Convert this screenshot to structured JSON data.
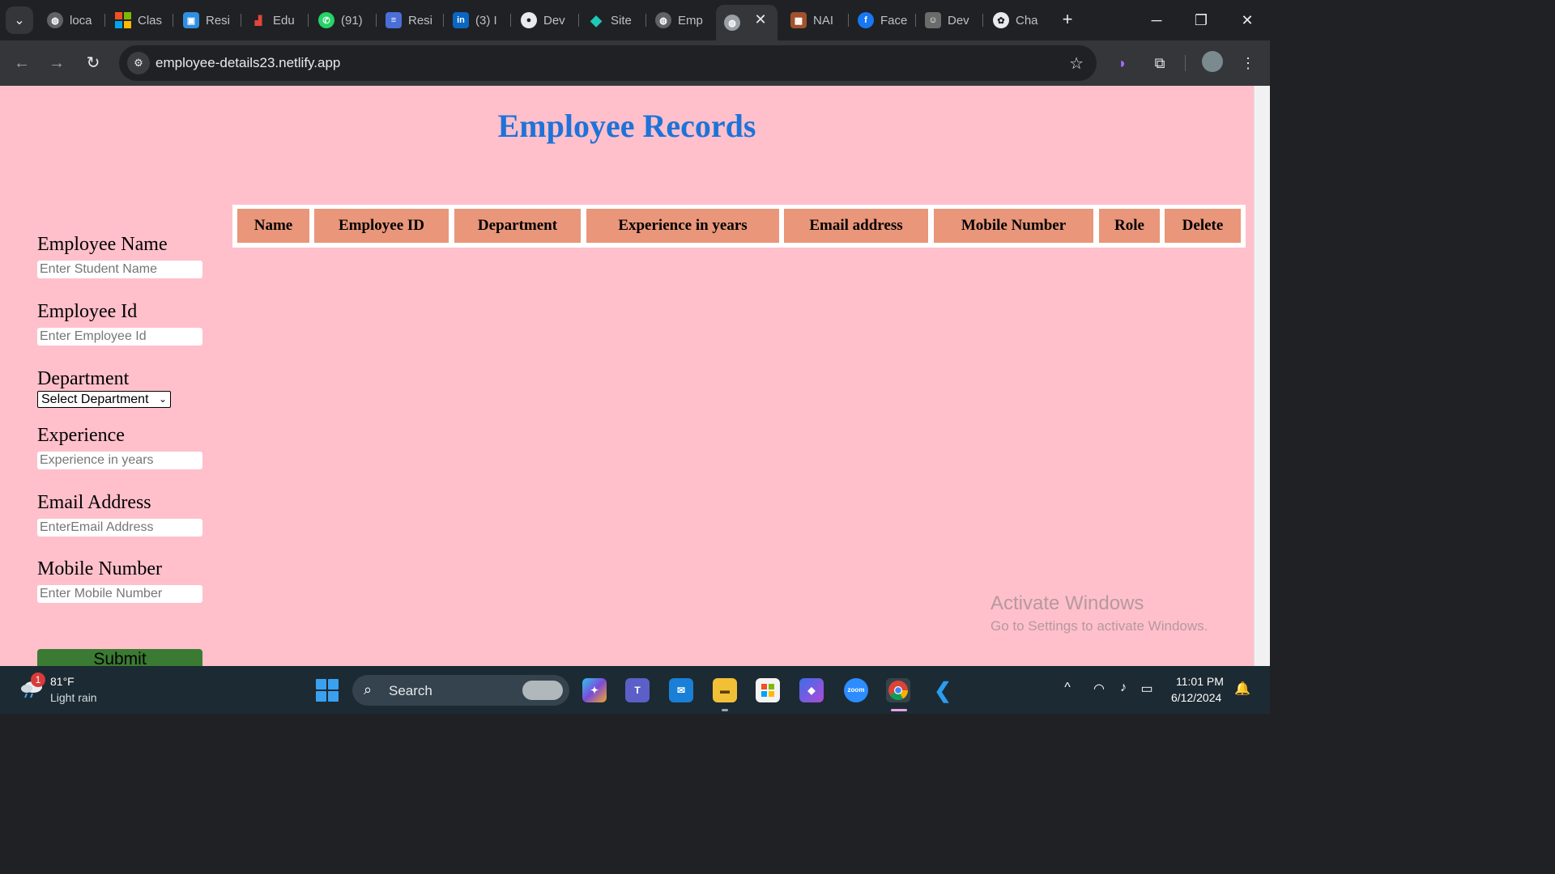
{
  "browser": {
    "tabs": [
      {
        "label": "loca",
        "icon": "globe-icon"
      },
      {
        "label": "Clas",
        "icon": "microsoft-icon"
      },
      {
        "label": "Resi",
        "icon": "resume-icon"
      },
      {
        "label": "Edu",
        "icon": "edu-icon"
      },
      {
        "label": "(91)",
        "icon": "whatsapp-icon"
      },
      {
        "label": "Resi",
        "icon": "document-icon"
      },
      {
        "label": "(3) I",
        "icon": "linkedin-icon"
      },
      {
        "label": "Dev",
        "icon": "github-icon"
      },
      {
        "label": "Site",
        "icon": "netlify-icon"
      },
      {
        "label": "Emp",
        "icon": "globe-icon"
      },
      {
        "label": "",
        "icon": "globe-icon",
        "active": true
      },
      {
        "label": "NAI",
        "icon": "movie-icon"
      },
      {
        "label": "Face",
        "icon": "facebook-icon"
      },
      {
        "label": "Dev",
        "icon": "profile-icon"
      },
      {
        "label": "Cha",
        "icon": "chatgpt-icon"
      }
    ],
    "url": "employee-details23.netlify.app"
  },
  "page": {
    "title": "Employee Records",
    "form": {
      "name_label": "Employee Name",
      "name_placeholder": "Enter Student Name",
      "id_label": "Employee Id",
      "id_placeholder": "Enter Employee Id",
      "department_label": "Department",
      "department_selected": "Select Department",
      "experience_label": "Experience",
      "experience_placeholder": "Experience in years",
      "email_label": "Email Address",
      "email_placeholder": "EnterEmail Address",
      "mobile_label": "Mobile Number",
      "mobile_placeholder": "Enter Mobile Number",
      "submit_label": "Submit"
    },
    "table": {
      "headers": [
        "Name",
        "Employee ID",
        "Department",
        "Experience in years",
        "Email address",
        "Mobile Number",
        "Role",
        "Delete"
      ],
      "rows": []
    },
    "watermark": {
      "title": "Activate Windows",
      "subtitle": "Go to Settings to activate Windows."
    }
  },
  "taskbar": {
    "weather": {
      "temp": "81°F",
      "desc": "Light rain",
      "badge": "1"
    },
    "search_label": "Search",
    "clock": {
      "time": "11:01 PM",
      "date": "6/12/2024"
    }
  },
  "colors": {
    "page_bg": "#ffc0cb",
    "title": "#1e73d8",
    "header_cell": "#e9967a",
    "submit": "#3b7a33"
  }
}
